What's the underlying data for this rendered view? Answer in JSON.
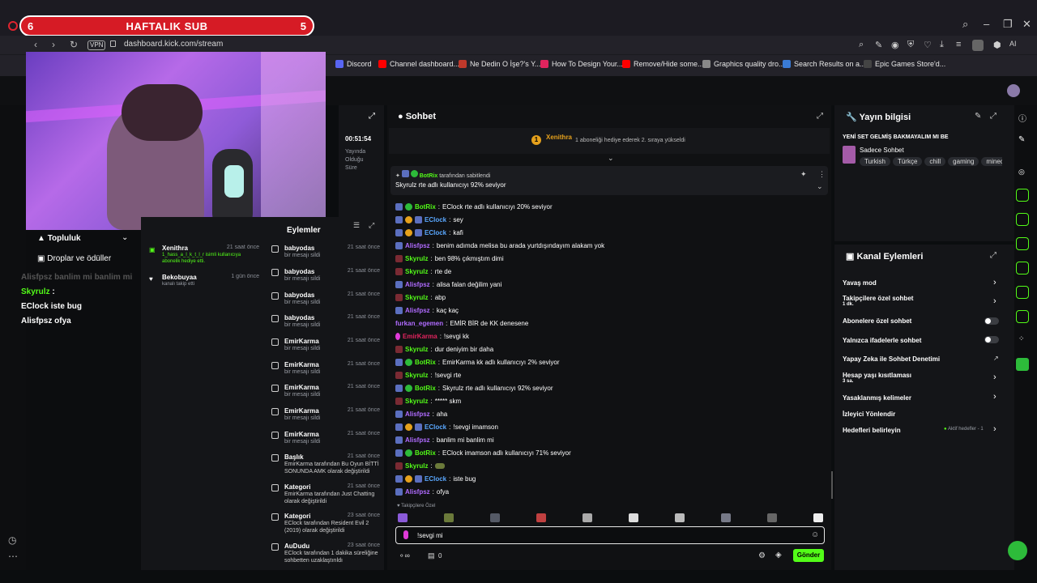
{
  "banner": {
    "title": "HAFTALIK SUB",
    "left_count": "6",
    "right_count": "5"
  },
  "browser": {
    "url": "dashboard.kick.com/stream",
    "vpn": "VPN",
    "ai": "AI",
    "bookmarks": [
      {
        "label": "Discord",
        "color": "#5865f2"
      },
      {
        "label": "Channel dashboard...",
        "color": "#ff0000"
      },
      {
        "label": "Ne Dedin O İşe?'s Y...",
        "color": "#c0392b"
      },
      {
        "label": "How To Design Your...",
        "color": "#e0245e"
      },
      {
        "label": "Remove/Hide some...",
        "color": "#ff0000"
      },
      {
        "label": "Graphics quality dro...",
        "color": "#888888"
      },
      {
        "label": "Search Results on a...",
        "color": "#3a7bd5"
      },
      {
        "label": "Epic Games Store'd...",
        "color": "#444444"
      }
    ]
  },
  "session": {
    "time": "00:51:54",
    "label": "Yayında Olduğu Süre"
  },
  "left": {
    "community": "Topluluk",
    "drops": "Droplar ve ödüller",
    "overlay_chat": [
      {
        "user": "Alisfpsz",
        "text": "banlim mi banlim mi",
        "color": "#555555"
      },
      {
        "user": "Skyrulz",
        "text": ":",
        "color": "#53fc18"
      },
      {
        "user": "EClock",
        "text": "iste bug",
        "color": "#ffffff"
      },
      {
        "user": "Alisfpsz",
        "text": "ofya",
        "color": "#ffffff"
      }
    ]
  },
  "events": {
    "title": "Eylemler",
    "left_items": [
      {
        "user": "Xenithra",
        "time": "21 saat önce",
        "text": "1_hass_a_l_k_t_l_r isimli kullanıcıya abonelik hediye etti."
      },
      {
        "user": "Bekobuyaa",
        "time": "1 gün önce",
        "text": "kanalı takip etti"
      }
    ],
    "items": [
      {
        "user": "babyodas",
        "time": "21 saat önce",
        "text": "bir mesajı sildi"
      },
      {
        "user": "babyodas",
        "time": "21 saat önce",
        "text": "bir mesajı sildi"
      },
      {
        "user": "babyodas",
        "time": "21 saat önce",
        "text": "bir mesajı sildi"
      },
      {
        "user": "babyodas",
        "time": "21 saat önce",
        "text": "bir mesajı sildi"
      },
      {
        "user": "EmirKarma",
        "time": "21 saat önce",
        "text": "bir mesajı sildi"
      },
      {
        "user": "EmirKarma",
        "time": "21 saat önce",
        "text": "bir mesajı sildi"
      },
      {
        "user": "EmirKarma",
        "time": "21 saat önce",
        "text": "bir mesajı sildi"
      },
      {
        "user": "EmirKarma",
        "time": "21 saat önce",
        "text": "bir mesajı sildi"
      },
      {
        "user": "EmirKarma",
        "time": "21 saat önce",
        "text": "bir mesajı sildi"
      },
      {
        "user": "Başlık",
        "time": "21 saat önce",
        "text": "EmirKarma tarafından Bu Oyun BİTTİ SONUNDA AMK olarak değiştirildi"
      },
      {
        "user": "Kategori",
        "time": "21 saat önce",
        "text": "EmirKarma tarafından Just Chatting olarak değiştirildi"
      },
      {
        "user": "Kategori",
        "time": "23 saat önce",
        "text": "EClock tarafından Resident Evil 2 (2019) olarak değiştirildi"
      },
      {
        "user": "AuDudu",
        "time": "23 saat önce",
        "text": "EClock tarafından 1 dakika süreliğine sohbetten uzaklaştırıldı"
      }
    ]
  },
  "chat": {
    "title": "Sohbet",
    "gift": {
      "user": "Xenithra",
      "rank": "1",
      "text": "1 aboneliği hediye ederek 2. sıraya yükseldi"
    },
    "pinned": {
      "by": "BotRix",
      "by_suffix": "tarafından sabitlendi",
      "text": "Skyrulz rte adlı kullanıcıyı 92% seviyor"
    },
    "messages": [
      {
        "user": "BotRix",
        "color": "#53fc18",
        "text": "EClock rte adlı kullanıcıyı 20% seviyor",
        "badges": [
          "b",
          "g"
        ]
      },
      {
        "user": "EClock",
        "color": "#5aa8ff",
        "text": "sey",
        "badges": [
          "b",
          "y",
          "b"
        ]
      },
      {
        "user": "EClock",
        "color": "#5aa8ff",
        "text": "kafi",
        "badges": [
          "b",
          "y",
          "b"
        ]
      },
      {
        "user": "Alisfpsz",
        "color": "#b06bff",
        "text": "benim adımda melisa bu arada yurtdışındayım alakam yok",
        "badges": [
          "b"
        ]
      },
      {
        "user": "Skyrulz",
        "color": "#53fc18",
        "text": "ben 98% çıkmıştım dimi",
        "badges": [
          "r"
        ]
      },
      {
        "user": "Skyrulz",
        "color": "#53fc18",
        "text": "rte de",
        "badges": [
          "r"
        ]
      },
      {
        "user": "Alisfpsz",
        "color": "#b06bff",
        "text": "alisa falan değilim yani",
        "badges": [
          "b"
        ]
      },
      {
        "user": "Skyrulz",
        "color": "#53fc18",
        "text": "abp",
        "badges": [
          "r"
        ]
      },
      {
        "user": "Alisfpsz",
        "color": "#b06bff",
        "text": "kaç kaç",
        "badges": [
          "b"
        ]
      },
      {
        "user": "furkan_egemen",
        "color": "#b06bff",
        "text": "EMİR BİR de KK denesene",
        "badges": []
      },
      {
        "user": "EmirKarma",
        "color": "#e0245e",
        "text": "!sevgi kk",
        "badges": [
          "p"
        ]
      },
      {
        "user": "Skyrulz",
        "color": "#53fc18",
        "text": "dur deniyim bir daha",
        "badges": [
          "r"
        ]
      },
      {
        "user": "BotRix",
        "color": "#53fc18",
        "text": "EmirKarma kk adlı kullanıcıyı 2% seviyor",
        "badges": [
          "b",
          "g"
        ]
      },
      {
        "user": "Skyrulz",
        "color": "#53fc18",
        "text": "!sevgi rte",
        "badges": [
          "r"
        ]
      },
      {
        "user": "BotRix",
        "color": "#53fc18",
        "text": "Skyrulz rte adlı kullanıcıyı 92% seviyor",
        "badges": [
          "b",
          "g"
        ]
      },
      {
        "user": "Skyrulz",
        "color": "#53fc18",
        "text": "***** skm",
        "badges": [
          "r"
        ]
      },
      {
        "user": "Alisfpsz",
        "color": "#b06bff",
        "text": "aha",
        "badges": [
          "b"
        ]
      },
      {
        "user": "EClock",
        "color": "#5aa8ff",
        "text": "!sevgi imamson",
        "badges": [
          "b",
          "y",
          "b"
        ]
      },
      {
        "user": "Alisfpsz",
        "color": "#b06bff",
        "text": "banlim mi banlim mi",
        "badges": [
          "b"
        ]
      },
      {
        "user": "BotRix",
        "color": "#53fc18",
        "text": "EClock imamson adlı kullanıcıyı 71% seviyor",
        "badges": [
          "b",
          "g"
        ]
      },
      {
        "user": "Skyrulz",
        "color": "#53fc18",
        "text": "",
        "badges": [
          "r"
        ]
      },
      {
        "user": "EClock",
        "color": "#5aa8ff",
        "text": "iste bug",
        "badges": [
          "b",
          "y",
          "b"
        ]
      },
      {
        "user": "Alisfpsz",
        "color": "#b06bff",
        "text": "ofya",
        "badges": [
          "b"
        ]
      }
    ],
    "followers_only": "Takipçilere Özel",
    "input_value": "!sevgi mi",
    "counter1": "0",
    "send": "Gönder"
  },
  "info": {
    "title": "Yayın bilgisi",
    "stream_title": "YENİ SET GELMİŞ BAKMAYALIM MI BE",
    "category": "Sadece Sohbet",
    "tags": [
      "Turkish",
      "Türkçe",
      "chill",
      "gaming",
      "minecra"
    ]
  },
  "mod": {
    "title": "Kanal Eylemleri",
    "slow": "Yavaş mod",
    "followers": "Takipçilere özel sohbet",
    "followers_sub": "1 dk.",
    "subs": "Abonelere özel sohbet",
    "emotes": "Yalnızca ifadelerle sohbet",
    "ai": "Yapay Zeka ile Sohbet Denetimi",
    "age": "Hesap yaşı kısıtlaması",
    "age_sub": "3 sa.",
    "banned": "Yasaklanmış kelimeler",
    "raid": "İzleyici Yönlendir",
    "goals": "Hedefleri belirleyin",
    "goals_status": "Aktif hedefler - 1"
  }
}
